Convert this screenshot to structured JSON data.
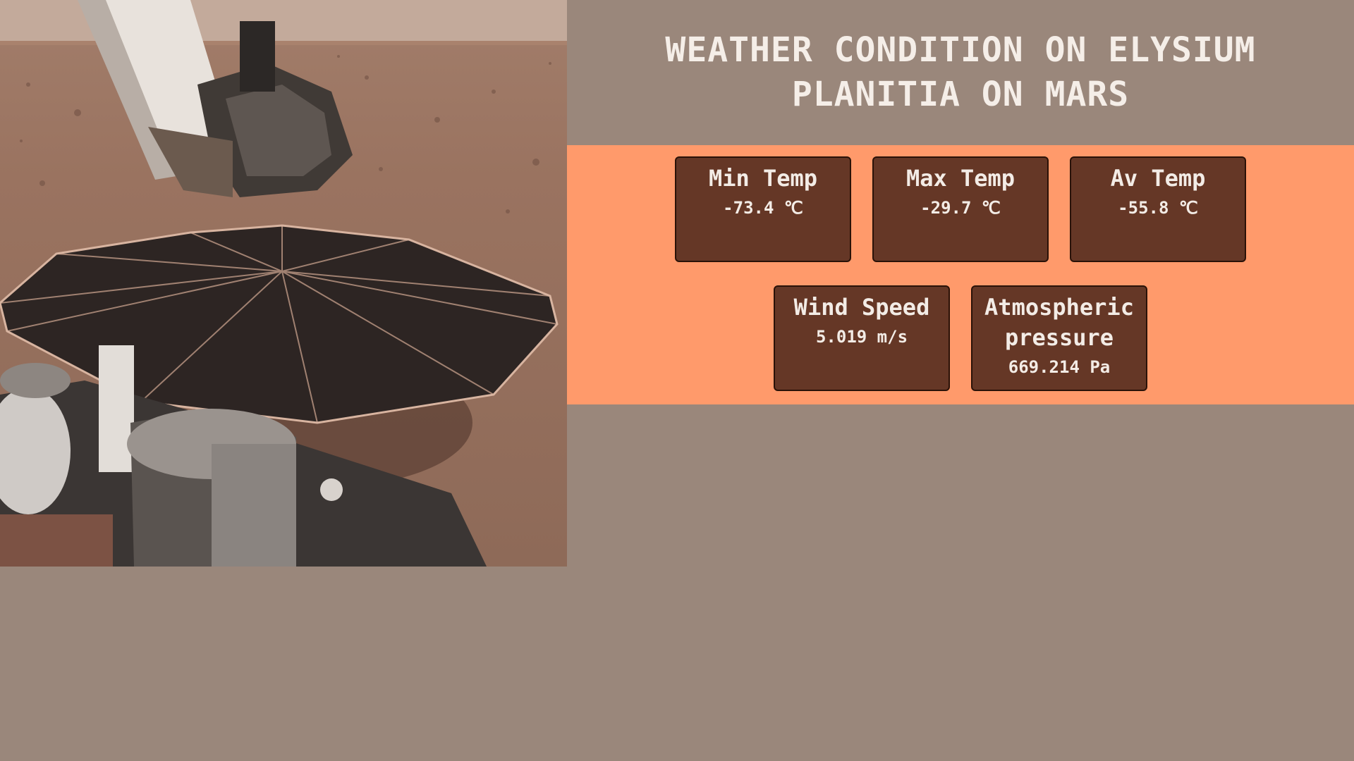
{
  "header": {
    "title": "WEATHER CONDITION ON ELYSIUM PLANITIA ON MARS"
  },
  "weather": {
    "min_temp": {
      "label": "Min Temp",
      "value": "-73.4 ℃"
    },
    "max_temp": {
      "label": "Max Temp",
      "value": "-29.7 ℃"
    },
    "av_temp": {
      "label": "Av Temp",
      "value": "-55.8 ℃"
    },
    "wind_speed": {
      "label": "Wind Speed",
      "value": "5.019 m/s"
    },
    "pressure": {
      "label": "Atmospheric pressure",
      "value": "669.214 Pa"
    }
  },
  "colors": {
    "page_background": "#9a877b",
    "band": "#ff9a6b",
    "card": "#653726",
    "text": "#f5eee8"
  }
}
